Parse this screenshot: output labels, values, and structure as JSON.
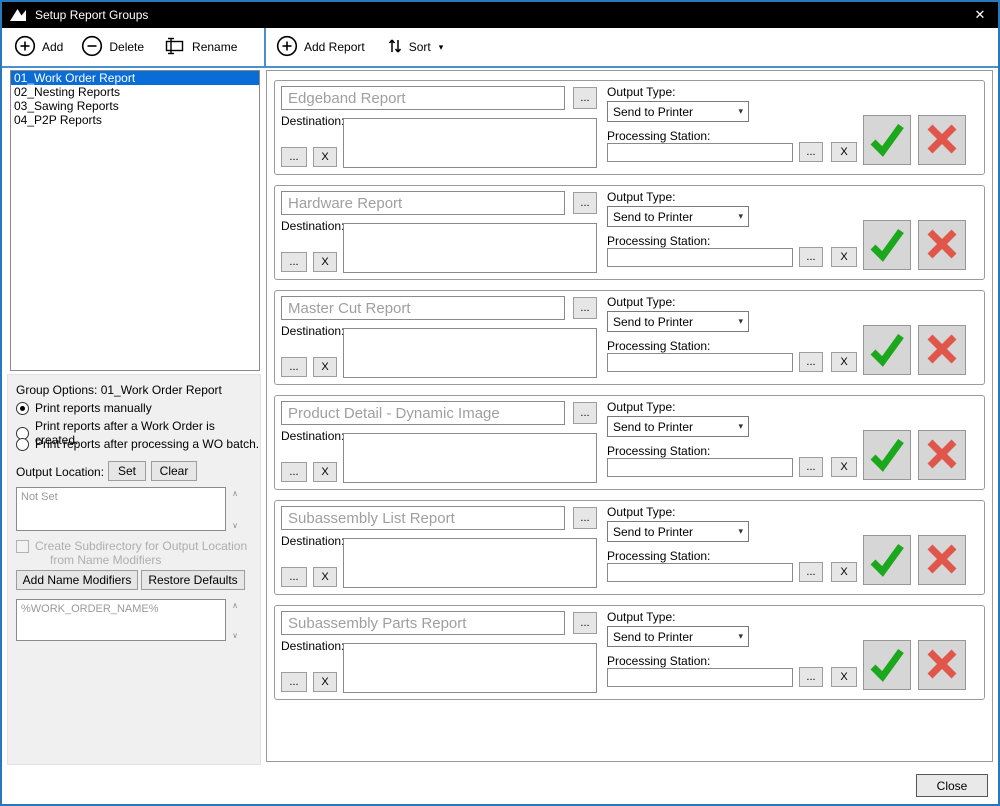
{
  "window": {
    "title": "Setup Report Groups"
  },
  "icons": {
    "close": "✕",
    "sort_caret": "▾",
    "combo_caret": "▾",
    "scroll_up": "∧",
    "scroll_down": "∨"
  },
  "toolbar": {
    "add": "Add",
    "delete": "Delete",
    "rename": "Rename",
    "add_report": "Add Report",
    "sort": "Sort"
  },
  "group_list": {
    "selected_index": 0,
    "items": [
      "01_Work Order Report",
      "02_Nesting Reports",
      "03_Sawing Reports",
      "04_P2P Reports"
    ]
  },
  "group_options": {
    "title": "Group Options: 01_Work Order Report",
    "radio_manual": "Print reports manually",
    "radio_after_created": "Print reports after a Work Order is created.",
    "radio_after_batch": "Print reports after processing a WO batch.",
    "selected_radio": "Print reports manually",
    "output_location_label": "Output Location:",
    "set_button": "Set",
    "clear_button": "Clear",
    "output_location_value": "Not Set",
    "subdir_label_1": "Create Subdirectory for Output Location",
    "subdir_label_2": "from Name Modifiers",
    "add_name_modifiers_button": "Add Name Modifiers",
    "restore_defaults_button": "Restore Defaults",
    "name_modifier_value": "%WORK_ORDER_NAME%"
  },
  "row_labels": {
    "output_type": "Output Type:",
    "destination": "Destination:",
    "processing_station": "Processing Station:",
    "browse": "...",
    "clear": "X"
  },
  "reports": [
    {
      "name": "Edgeband Report",
      "output_type": "Send to Printer"
    },
    {
      "name": "Hardware Report",
      "output_type": "Send to Printer"
    },
    {
      "name": "Master Cut Report",
      "output_type": "Send to Printer"
    },
    {
      "name": "Product Detail - Dynamic Image",
      "output_type": "Send to Printer"
    },
    {
      "name": "Subassembly List Report",
      "output_type": "Send to Printer"
    },
    {
      "name": "Subassembly Parts Report",
      "output_type": "Send to Printer"
    }
  ],
  "footer": {
    "close": "Close"
  },
  "colors": {
    "accent_blue": "#2878be",
    "selection_blue": "#0a6cd6",
    "accept_green": "#1ca81c",
    "reject_red": "#e0564a",
    "titlebar_black": "#000000"
  }
}
